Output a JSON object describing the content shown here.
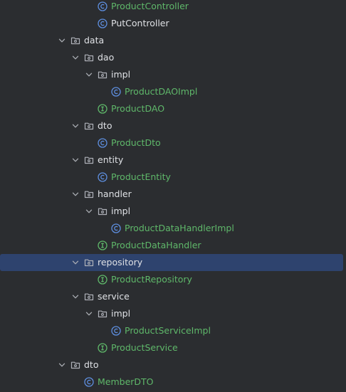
{
  "tree": {
    "items": [
      {
        "label": "ProductController",
        "kind": "class",
        "level": 3,
        "expanded": null
      },
      {
        "label": "PutController",
        "kind": "class-plain",
        "level": 3,
        "expanded": null
      },
      {
        "label": "data",
        "kind": "folder",
        "level": 1,
        "expanded": true
      },
      {
        "label": "dao",
        "kind": "folder",
        "level": 2,
        "expanded": true
      },
      {
        "label": "impl",
        "kind": "folder",
        "level": 3,
        "expanded": true
      },
      {
        "label": "ProductDAOImpl",
        "kind": "class",
        "level": 4,
        "expanded": null
      },
      {
        "label": "ProductDAO",
        "kind": "interface",
        "level": 3,
        "expanded": null
      },
      {
        "label": "dto",
        "kind": "folder",
        "level": 2,
        "expanded": true
      },
      {
        "label": "ProductDto",
        "kind": "class",
        "level": 3,
        "expanded": null
      },
      {
        "label": "entity",
        "kind": "folder",
        "level": 2,
        "expanded": true
      },
      {
        "label": "ProductEntity",
        "kind": "class",
        "level": 3,
        "expanded": null
      },
      {
        "label": "handler",
        "kind": "folder",
        "level": 2,
        "expanded": true
      },
      {
        "label": "impl",
        "kind": "folder",
        "level": 3,
        "expanded": true
      },
      {
        "label": "ProductDataHandlerImpl",
        "kind": "class",
        "level": 4,
        "expanded": null
      },
      {
        "label": "ProductDataHandler",
        "kind": "interface",
        "level": 3,
        "expanded": null
      },
      {
        "label": "repository",
        "kind": "folder",
        "level": 2,
        "expanded": true,
        "selected": true
      },
      {
        "label": "ProductRepository",
        "kind": "interface",
        "level": 3,
        "expanded": null
      },
      {
        "label": "service",
        "kind": "folder",
        "level": 2,
        "expanded": true
      },
      {
        "label": "impl",
        "kind": "folder",
        "level": 3,
        "expanded": true
      },
      {
        "label": "ProductServiceImpl",
        "kind": "class",
        "level": 4,
        "expanded": null
      },
      {
        "label": "ProductService",
        "kind": "interface",
        "level": 3,
        "expanded": null
      },
      {
        "label": "dto",
        "kind": "folder",
        "level": 1,
        "expanded": true
      },
      {
        "label": "MemberDTO",
        "kind": "class",
        "level": 2,
        "expanded": null
      }
    ]
  },
  "colors": {
    "background": "#2b2d30",
    "selection": "#2e436e",
    "text": "#dfe1e5",
    "java_file_text": "#5fb86a",
    "class_icon": "#5e8fe0",
    "interface_icon": "#5fb86a",
    "folder_icon": "#aeb1b8"
  },
  "icons": {
    "class": "class-icon",
    "interface": "interface-icon",
    "folder": "package-folder-icon",
    "chevron": "chevron-down-icon"
  }
}
